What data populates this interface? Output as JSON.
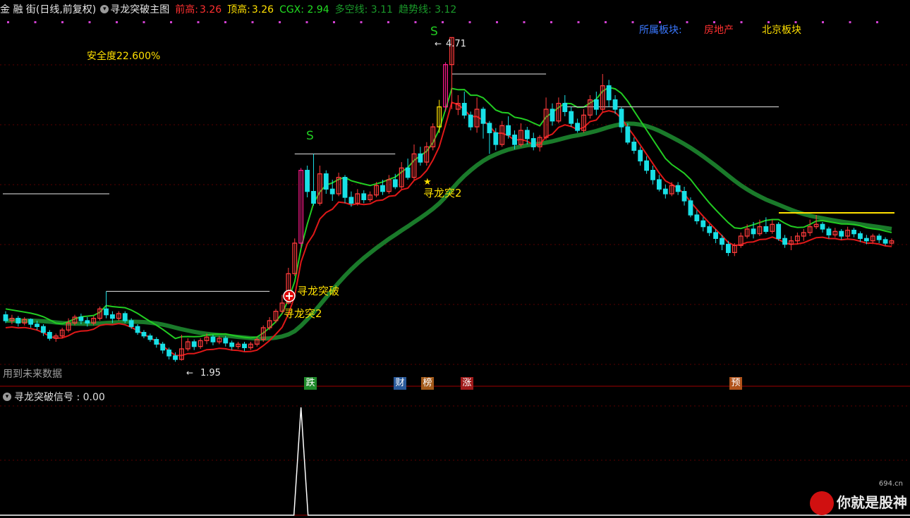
{
  "header": {
    "market": "金 融 街(日线,前复权)",
    "indicator": "寻龙突破主图",
    "prev_high_label": "前高:",
    "prev_high_value": "3.26",
    "top_label": "顶高:",
    "top_value": "3.26",
    "cgx": "CGX: 2.94",
    "duokong": "多空线: 3.11",
    "trend": "趋势线: 3.12"
  },
  "sector": {
    "label": "所属板块:",
    "item1": "房地产",
    "item2": "北京板块"
  },
  "safety": "安全度22.600%",
  "future_note": "用到未来数据",
  "sub_title": "寻龙突破信号 : 0.00",
  "badges": [
    {
      "text": "跌",
      "color": "#1f8a2a"
    },
    {
      "text": "财",
      "color": "#2a5a9a"
    },
    {
      "text": "榜",
      "color": "#a35a1a"
    },
    {
      "text": "涨",
      "color": "#a01a1a"
    },
    {
      "text": "预",
      "color": "#b0521a"
    }
  ],
  "annotations": {
    "low_label": "1.95",
    "high_label": "4.71",
    "s1": "S",
    "s2": "S",
    "breakout": "寻龙突破",
    "breakout2_a": "寻龙突2",
    "breakout2_b": "寻龙突2",
    "star": "★"
  },
  "watermark": {
    "text": "你就是股神",
    "site": "694.cn"
  },
  "colors": {
    "up": "#ff3b3b",
    "down": "#19e0e6",
    "trend": "#1a7a2a",
    "band": "#e01818",
    "upper": "#22cc22"
  },
  "chart_data": {
    "type": "candlestick",
    "ylim": [
      1.85,
      4.85
    ],
    "candles": [
      [
        2.35,
        2.3,
        2.38,
        2.28
      ],
      [
        2.3,
        2.32,
        2.35,
        2.27
      ],
      [
        2.32,
        2.28,
        2.34,
        2.25
      ],
      [
        2.28,
        2.31,
        2.33,
        2.26
      ],
      [
        2.31,
        2.27,
        2.32,
        2.24
      ],
      [
        2.27,
        2.25,
        2.3,
        2.22
      ],
      [
        2.25,
        2.2,
        2.27,
        2.17
      ],
      [
        2.2,
        2.15,
        2.22,
        2.13
      ],
      [
        2.15,
        2.17,
        2.19,
        2.12
      ],
      [
        2.17,
        2.22,
        2.24,
        2.15
      ],
      [
        2.22,
        2.28,
        2.32,
        2.2
      ],
      [
        2.28,
        2.33,
        2.35,
        2.26
      ],
      [
        2.33,
        2.3,
        2.36,
        2.27
      ],
      [
        2.3,
        2.28,
        2.33,
        2.25
      ],
      [
        2.28,
        2.32,
        2.34,
        2.26
      ],
      [
        2.32,
        2.4,
        2.42,
        2.3
      ],
      [
        2.4,
        2.35,
        2.55,
        2.32
      ],
      [
        2.35,
        2.32,
        2.38,
        2.28
      ],
      [
        2.32,
        2.36,
        2.38,
        2.3
      ],
      [
        2.36,
        2.3,
        2.38,
        2.28
      ],
      [
        2.3,
        2.25,
        2.32,
        2.23
      ],
      [
        2.25,
        2.2,
        2.27,
        2.18
      ],
      [
        2.2,
        2.17,
        2.22,
        2.15
      ],
      [
        2.17,
        2.14,
        2.19,
        2.12
      ],
      [
        2.14,
        2.1,
        2.16,
        2.07
      ],
      [
        2.1,
        2.05,
        2.12,
        2.02
      ],
      [
        2.05,
        2.0,
        2.07,
        1.97
      ],
      [
        2.0,
        1.97,
        2.03,
        1.95
      ],
      [
        1.97,
        2.06,
        2.18,
        1.96
      ],
      [
        2.06,
        2.12,
        2.15,
        2.04
      ],
      [
        2.12,
        2.08,
        2.14,
        2.05
      ],
      [
        2.08,
        2.13,
        2.15,
        2.06
      ],
      [
        2.13,
        2.16,
        2.19,
        2.1
      ],
      [
        2.16,
        2.12,
        2.18,
        2.09
      ],
      [
        2.12,
        2.15,
        2.17,
        2.1
      ],
      [
        2.15,
        2.11,
        2.17,
        2.08
      ],
      [
        2.11,
        2.08,
        2.13,
        2.05
      ],
      [
        2.08,
        2.1,
        2.12,
        2.06
      ],
      [
        2.1,
        2.07,
        2.12,
        2.04
      ],
      [
        2.07,
        2.1,
        2.12,
        2.05
      ],
      [
        2.1,
        2.14,
        2.16,
        2.08
      ],
      [
        2.14,
        2.24,
        2.26,
        2.12
      ],
      [
        2.24,
        2.3,
        2.33,
        2.22
      ],
      [
        2.3,
        2.38,
        2.4,
        2.28
      ],
      [
        2.38,
        2.45,
        2.52,
        2.36
      ],
      [
        2.45,
        2.7,
        2.75,
        2.44
      ],
      [
        2.7,
        2.96,
        3.0,
        2.68
      ],
      [
        2.96,
        3.58,
        3.6,
        2.92
      ],
      [
        3.58,
        3.4,
        3.62,
        3.35
      ],
      [
        3.4,
        3.3,
        3.72,
        3.28
      ],
      [
        3.3,
        3.55,
        3.62,
        3.28
      ],
      [
        3.55,
        3.42,
        3.58,
        3.38
      ],
      [
        3.42,
        3.38,
        3.5,
        3.32
      ],
      [
        3.38,
        3.52,
        3.56,
        3.36
      ],
      [
        3.52,
        3.35,
        3.54,
        3.3
      ],
      [
        3.35,
        3.3,
        3.4,
        3.27
      ],
      [
        3.3,
        3.38,
        3.42,
        3.28
      ],
      [
        3.38,
        3.33,
        3.41,
        3.3
      ],
      [
        3.33,
        3.37,
        3.4,
        3.31
      ],
      [
        3.37,
        3.45,
        3.48,
        3.35
      ],
      [
        3.45,
        3.4,
        3.5,
        3.37
      ],
      [
        3.4,
        3.5,
        3.54,
        3.38
      ],
      [
        3.5,
        3.44,
        3.55,
        3.42
      ],
      [
        3.44,
        3.6,
        3.65,
        3.42
      ],
      [
        3.6,
        3.52,
        3.68,
        3.5
      ],
      [
        3.52,
        3.72,
        3.8,
        3.5
      ],
      [
        3.72,
        3.65,
        3.78,
        3.62
      ],
      [
        3.65,
        3.78,
        3.82,
        3.62
      ],
      [
        3.78,
        3.95,
        3.98,
        3.75
      ],
      [
        3.95,
        4.12,
        4.18,
        3.9
      ],
      [
        4.12,
        4.48,
        4.5,
        4.08
      ],
      [
        4.48,
        4.71,
        4.71,
        4.1
      ],
      [
        4.1,
        4.15,
        4.22,
        4.05
      ],
      [
        4.15,
        4.05,
        4.25,
        4.02
      ],
      [
        4.05,
        3.95,
        4.08,
        3.92
      ],
      [
        3.95,
        4.1,
        4.2,
        3.9
      ],
      [
        4.1,
        3.98,
        4.12,
        3.85
      ],
      [
        3.98,
        3.9,
        4.0,
        3.72
      ],
      [
        3.9,
        3.8,
        3.94,
        3.75
      ],
      [
        3.8,
        3.96,
        4.0,
        3.78
      ],
      [
        3.96,
        3.88,
        4.04,
        3.85
      ],
      [
        3.88,
        3.8,
        3.92,
        3.76
      ],
      [
        3.8,
        3.92,
        3.98,
        3.78
      ],
      [
        3.92,
        3.85,
        3.95,
        3.8
      ],
      [
        3.85,
        3.78,
        3.9,
        3.75
      ],
      [
        3.78,
        3.86,
        3.88,
        3.74
      ],
      [
        3.86,
        4.1,
        4.2,
        3.84
      ],
      [
        4.1,
        4.0,
        4.15,
        3.96
      ],
      [
        4.0,
        4.15,
        4.2,
        3.98
      ],
      [
        4.15,
        4.08,
        4.22,
        4.04
      ],
      [
        4.08,
        3.98,
        4.12,
        3.95
      ],
      [
        3.98,
        3.92,
        4.02,
        3.9
      ],
      [
        3.92,
        4.05,
        4.1,
        3.9
      ],
      [
        4.05,
        4.18,
        4.22,
        4.02
      ],
      [
        4.18,
        4.1,
        4.25,
        4.05
      ],
      [
        4.1,
        4.3,
        4.4,
        4.08
      ],
      [
        4.3,
        4.18,
        4.35,
        4.12
      ],
      [
        4.18,
        4.1,
        4.22,
        4.06
      ],
      [
        4.1,
        3.95,
        4.12,
        3.9
      ],
      [
        3.95,
        3.82,
        3.98,
        3.8
      ],
      [
        3.82,
        3.75,
        3.86,
        3.72
      ],
      [
        3.75,
        3.66,
        3.78,
        3.62
      ],
      [
        3.66,
        3.58,
        3.7,
        3.55
      ],
      [
        3.58,
        3.5,
        3.62,
        3.46
      ],
      [
        3.5,
        3.42,
        3.54,
        3.4
      ],
      [
        3.42,
        3.38,
        3.46,
        3.34
      ],
      [
        3.38,
        3.45,
        3.48,
        3.36
      ],
      [
        3.45,
        3.4,
        3.48,
        3.37
      ],
      [
        3.4,
        3.32,
        3.44,
        3.28
      ],
      [
        3.32,
        3.2,
        3.35,
        3.18
      ],
      [
        3.2,
        3.15,
        3.24,
        3.12
      ],
      [
        3.15,
        3.1,
        3.18,
        3.06
      ],
      [
        3.1,
        3.05,
        3.12,
        3.02
      ],
      [
        3.05,
        3.0,
        3.08,
        2.96
      ],
      [
        3.0,
        2.95,
        3.03,
        2.9
      ],
      [
        2.95,
        2.88,
        2.98,
        2.85
      ],
      [
        2.88,
        2.94,
        2.96,
        2.85
      ],
      [
        2.94,
        3.02,
        3.05,
        2.92
      ],
      [
        3.02,
        3.08,
        3.12,
        3.0
      ],
      [
        3.08,
        3.04,
        3.14,
        3.0
      ],
      [
        3.04,
        3.1,
        3.16,
        3.02
      ],
      [
        3.1,
        3.06,
        3.18,
        3.04
      ],
      [
        3.06,
        3.12,
        3.16,
        3.04
      ],
      [
        3.12,
        3.0,
        3.14,
        2.98
      ],
      [
        3.0,
        2.95,
        3.03,
        2.92
      ],
      [
        2.95,
        2.98,
        3.02,
        2.9
      ],
      [
        2.98,
        3.02,
        3.05,
        2.95
      ],
      [
        3.02,
        3.05,
        3.08,
        2.98
      ],
      [
        3.05,
        3.1,
        3.16,
        3.02
      ],
      [
        3.1,
        3.12,
        3.2,
        3.08
      ],
      [
        3.12,
        3.08,
        3.14,
        3.05
      ],
      [
        3.08,
        3.03,
        3.1,
        3.0
      ],
      [
        3.03,
        3.06,
        3.09,
        3.01
      ],
      [
        3.06,
        3.02,
        3.08,
        2.99
      ],
      [
        3.02,
        3.07,
        3.1,
        3.0
      ],
      [
        3.07,
        3.04,
        3.09,
        3.01
      ],
      [
        3.04,
        3.0,
        3.06,
        2.97
      ],
      [
        3.0,
        2.98,
        3.03,
        2.95
      ],
      [
        2.98,
        3.02,
        3.04,
        2.96
      ],
      [
        3.02,
        2.99,
        3.04,
        2.96
      ],
      [
        2.99,
        2.96,
        3.01,
        2.94
      ],
      [
        2.96,
        2.98,
        3.0,
        2.94
      ]
    ],
    "signal": {
      "index": 47,
      "value": 1.0
    }
  }
}
